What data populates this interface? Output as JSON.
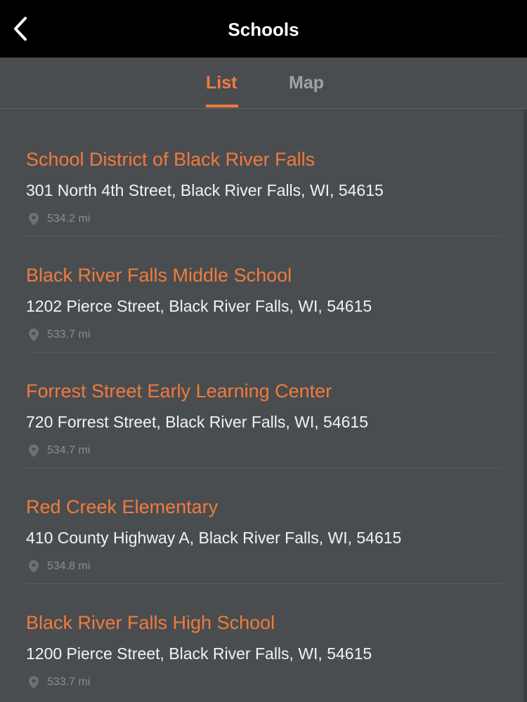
{
  "header": {
    "title": "Schools",
    "back_icon": "chevron-left-icon"
  },
  "tabs": [
    {
      "label": "List",
      "active": true
    },
    {
      "label": "Map",
      "active": false
    }
  ],
  "colors": {
    "accent": "#f07b3c",
    "background": "#4a4d50",
    "header": "#000000"
  },
  "schools": [
    {
      "name": "School District of Black River Falls",
      "address": "301 North 4th Street, Black River Falls, WI, 54615",
      "distance": "534.2 mi"
    },
    {
      "name": "Black River Falls Middle School",
      "address": "1202 Pierce Street, Black River Falls, WI, 54615",
      "distance": "533.7 mi"
    },
    {
      "name": "Forrest Street Early Learning Center",
      "address": "720 Forrest Street, Black River Falls, WI, 54615",
      "distance": "534.7 mi"
    },
    {
      "name": "Red Creek Elementary",
      "address": "410 County Highway A, Black River Falls, WI, 54615",
      "distance": "534.8 mi"
    },
    {
      "name": "Black River Falls High School",
      "address": "1200 Pierce Street, Black River Falls, WI, 54615",
      "distance": "533.7 mi"
    }
  ]
}
